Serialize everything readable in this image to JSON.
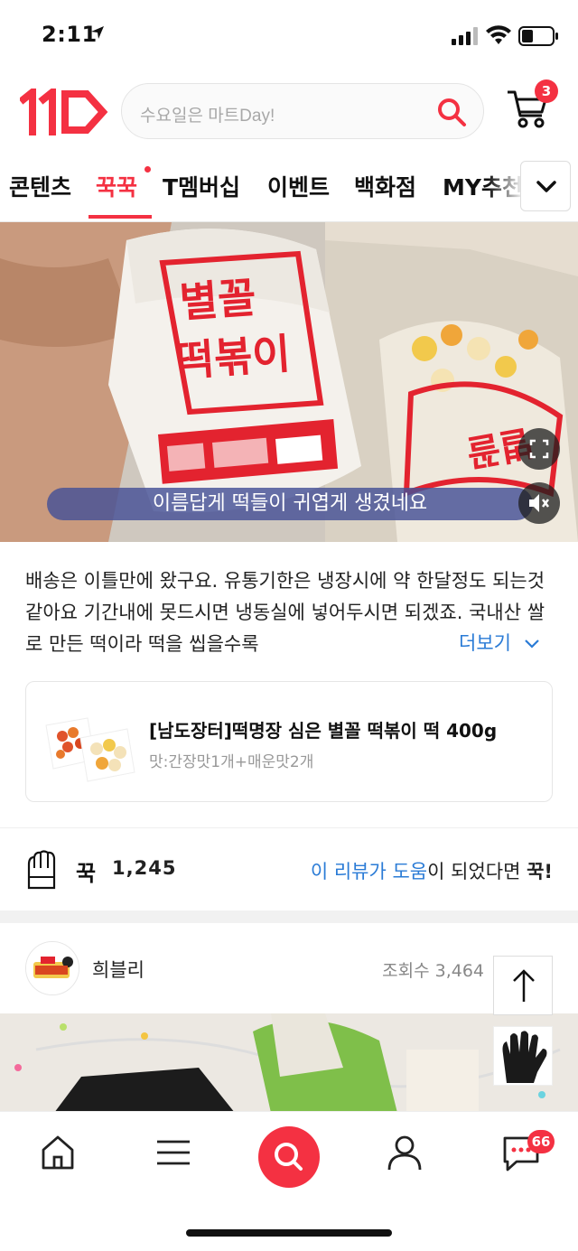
{
  "status_bar": {
    "time": "2:11"
  },
  "header": {
    "logo": "11번가",
    "search_placeholder": "수요일은 마트Day!",
    "cart_count": "3"
  },
  "tabs": [
    {
      "label": "콘텐츠"
    },
    {
      "label": "꾹꾹"
    },
    {
      "label": "T멤버십"
    },
    {
      "label": "이벤트"
    },
    {
      "label": "백화점"
    },
    {
      "label": "MY추천"
    }
  ],
  "video": {
    "subtitle": "이름답게 떡들이 귀엽게 생겼네요",
    "package_text": "별꼴 떡볶이"
  },
  "review": {
    "text": "배송은 이틀만에 왔구요. 유통기한은 냉장시에 약 한달정도 되는것 같아요 기간내에 못드시면 냉동실에 넣어두시면 되겠죠. 국내산 쌀로 만든 떡이라 떡을 씹을수록",
    "more_label": "더보기"
  },
  "product": {
    "title": "[남도장터]떡명장 심은 별꼴 떡볶이 떡 400g",
    "option": "맛:간장맛1개+매운맛2개"
  },
  "like_bar": {
    "kkuk_label": "꾹",
    "count": "1,245",
    "help_prefix": "이 리뷰가 도움",
    "help_middle": "이 되었다면 ",
    "help_suffix": "꾹!"
  },
  "next_post": {
    "author": "희블리",
    "views": "조회수 3,464"
  },
  "bottom_nav": {
    "chat_badge": "66"
  },
  "colors": {
    "brand": "#f43142",
    "link": "#2a7bd6"
  }
}
